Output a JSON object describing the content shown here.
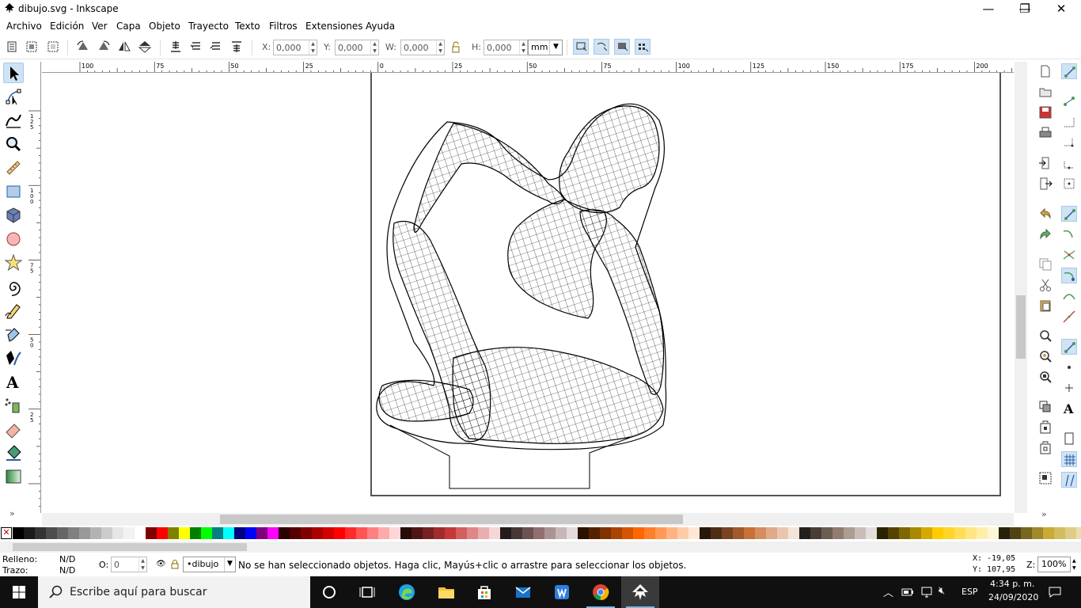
{
  "window": {
    "title": "dibujo.svg - Inkscape",
    "minimize_glyph": "—",
    "maximize_glyph": "❐",
    "close_glyph": "✕"
  },
  "menu": [
    "Archivo",
    "Edición",
    "Ver",
    "Capa",
    "Objeto",
    "Trayecto",
    "Texto",
    "Filtros",
    "Extensiones",
    "Ayuda"
  ],
  "toolbar": {
    "x_label": "X:",
    "x_value": "0,000",
    "y_label": "Y:",
    "y_value": "0,000",
    "w_label": "W:",
    "w_value": "0,000",
    "h_label": "H:",
    "h_value": "0,000",
    "unit": "mm"
  },
  "ruler": {
    "h_labels": [
      "100",
      "75",
      "50",
      "25",
      "0",
      "25",
      "50",
      "75",
      "100",
      "125",
      "150",
      "175",
      "200"
    ],
    "v_labels": [
      "1\n2\n5",
      "1\n0\n0",
      "7\n5",
      "5\n0",
      "2\n5"
    ]
  },
  "palette": {
    "none_glyph": "✕",
    "colors": [
      "#000000",
      "#1a1a1a",
      "#333333",
      "#4d4d4d",
      "#666666",
      "#808080",
      "#999999",
      "#b3b3b3",
      "#cccccc",
      "#e6e6e6",
      "#f2f2f2",
      "#ffffff",
      "#800000",
      "#ff0000",
      "#808000",
      "#ffff00",
      "#008000",
      "#00ff00",
      "#008080",
      "#00ffff",
      "#000080",
      "#0000ff",
      "#800080",
      "#ff00ff",
      "#2b0000",
      "#550000",
      "#800000",
      "#aa0000",
      "#d40000",
      "#ff0000",
      "#ff2a2a",
      "#ff5555",
      "#ff8080",
      "#ffaaaa",
      "#ffd5d5",
      "#280b0b",
      "#501616",
      "#782121",
      "#a02c2c",
      "#c83737",
      "#d35f5f",
      "#de8787",
      "#e9afaf",
      "#f4d7d7",
      "#241c1c",
      "#483737",
      "#6c5353",
      "#916f6f",
      "#ac9393",
      "#c8b7b7",
      "#e3dbdb",
      "#2b1100",
      "#552200",
      "#803300",
      "#aa4400",
      "#d45500",
      "#ff6600",
      "#ff7f2a",
      "#ff9955",
      "#ffb380",
      "#ffccaa",
      "#ffe6d5",
      "#28170b",
      "#502d16",
      "#784421",
      "#a05a2c",
      "#c87137",
      "#d38d5f",
      "#deaa87",
      "#e9c6af",
      "#f4e3d7",
      "#241f1c",
      "#483e37",
      "#6c5d53",
      "#917c6f",
      "#ac9d93",
      "#c8beb7",
      "#e3dedb",
      "#2b2200",
      "#554400",
      "#806600",
      "#aa8800",
      "#d4aa00",
      "#ffcc00",
      "#ffd42a",
      "#ffdd55",
      "#ffe680",
      "#ffeeaa",
      "#fff6d5",
      "#28220b",
      "#504416",
      "#786721",
      "#a0892c",
      "#c8ab37",
      "#d3bc5f",
      "#decd87",
      "#e9ddaf",
      "#f4eed7",
      "#24221c",
      "#484537",
      "#6c6753",
      "#918a6f"
    ]
  },
  "status": {
    "fill_label": "Relleno:",
    "fill_value": "N/D",
    "stroke_label": "Trazo:",
    "stroke_value": "N/D",
    "opacity_label": "O:",
    "opacity_value": "0",
    "layer": "•dibujo",
    "message": "No se han seleccionado objetos. Haga clic, Mayús+clic o arrastre para seleccionar los objetos.",
    "cursor_x_label": "X:",
    "cursor_x": "-19,05",
    "cursor_y_label": "Y:",
    "cursor_y": "107,95",
    "zoom_label": "Z:",
    "zoom": "100%"
  },
  "taskbar": {
    "search_placeholder": "Escribe aquí para buscar",
    "language": "ESP",
    "time": "4:34 p. m.",
    "date": "24/09/2020"
  },
  "colors": {
    "accent": "#cfe3f5",
    "taskbar": "#101010",
    "page_border": "#555555"
  }
}
